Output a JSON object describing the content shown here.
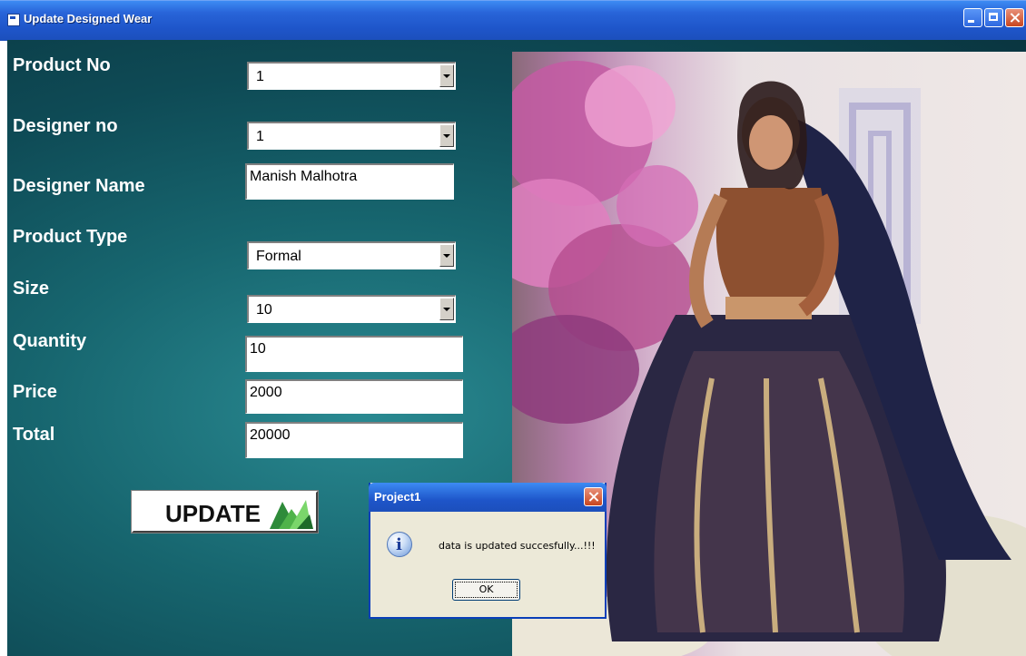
{
  "window": {
    "title": "Update Designed Wear"
  },
  "form": {
    "product_no": {
      "label": "Product No",
      "value": "1"
    },
    "designer_no": {
      "label": "Designer no",
      "value": "1"
    },
    "designer_name": {
      "label": "Designer Name",
      "value": "Manish Malhotra"
    },
    "product_type": {
      "label": "Product Type",
      "value": "Formal"
    },
    "size": {
      "label": "Size",
      "value": "10"
    },
    "quantity": {
      "label": "Quantity",
      "value": "10"
    },
    "price": {
      "label": "Price",
      "value": "2000"
    },
    "total": {
      "label": "Total",
      "value": "20000"
    },
    "update_button": "UPDATE"
  },
  "message_box": {
    "title": "Project1",
    "message": "data is updated succesfully...!!!",
    "ok_label": "OK",
    "icon": "info-icon"
  },
  "colors": {
    "title_bar": "#1e55c9",
    "form_background": "#17666f",
    "label_text": "#ffffff"
  }
}
